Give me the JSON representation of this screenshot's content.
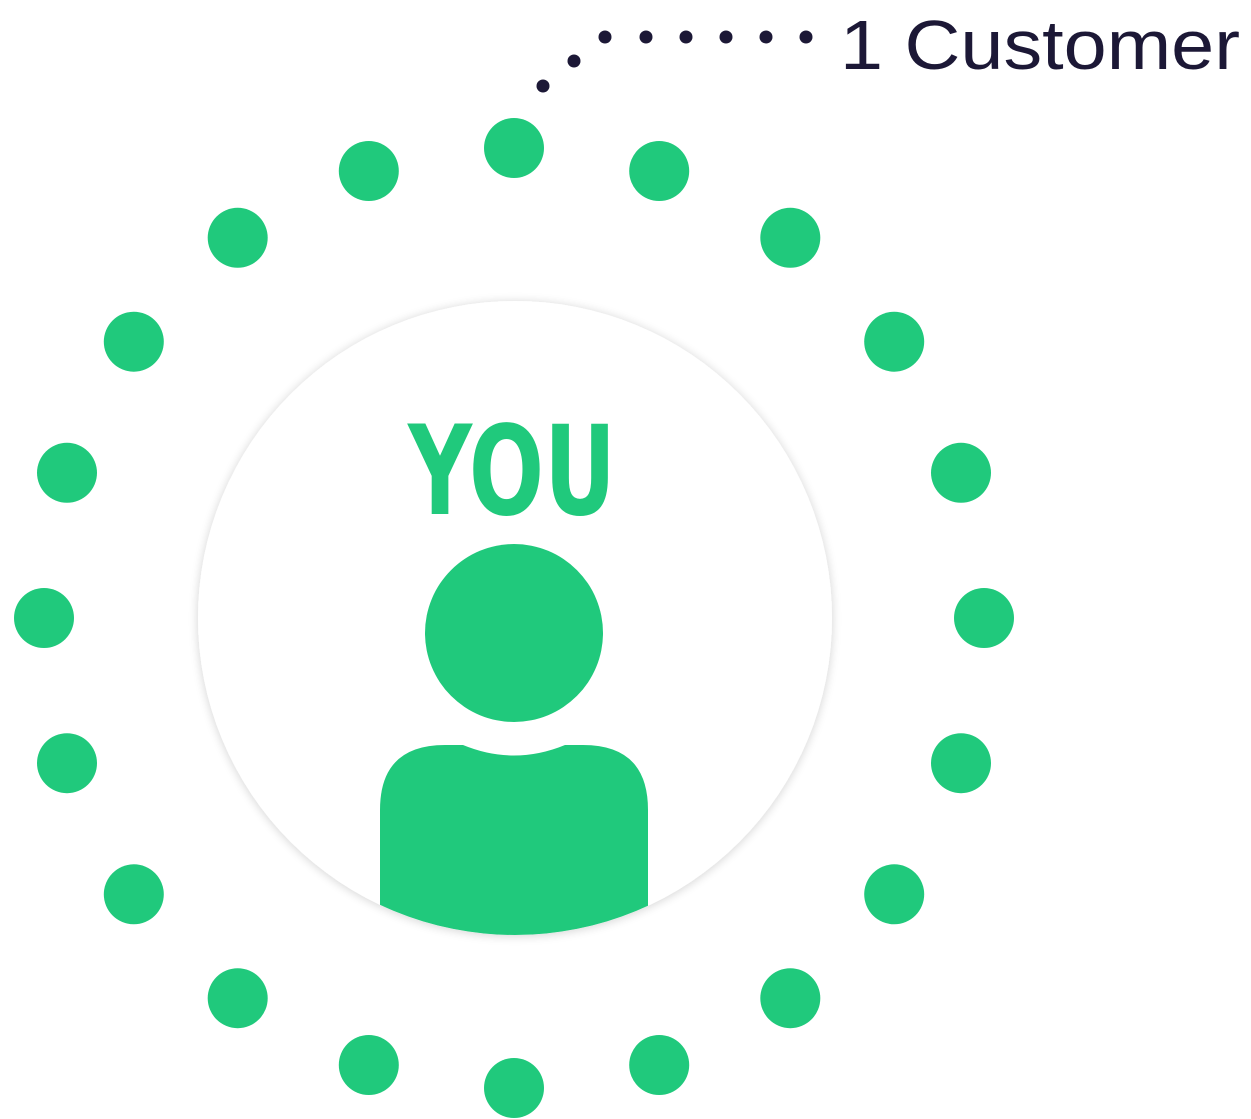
{
  "center_label": "YOU",
  "callout_label": "1 Customer",
  "icon": "person-icon",
  "ring": {
    "count": 20,
    "highlighted_index": 0
  },
  "colors": {
    "accent": "#20c97c",
    "text_dark": "#1c1836",
    "background": "#ffffff",
    "circle_fill": "#ffffff"
  }
}
